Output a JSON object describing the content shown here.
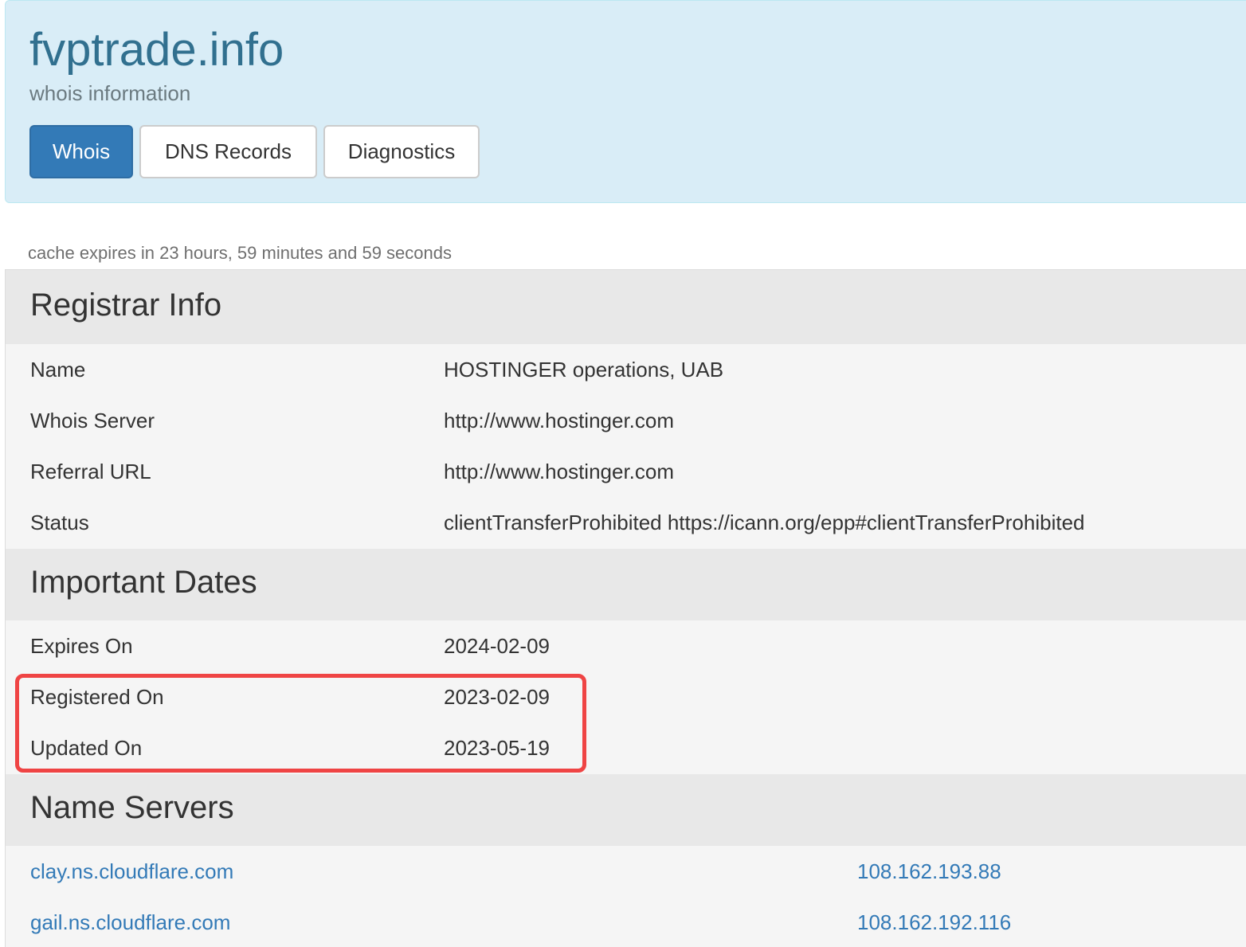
{
  "header": {
    "domain": "fvptrade.info",
    "subtitle": "whois information",
    "tabs": [
      "Whois",
      "DNS Records",
      "Diagnostics"
    ]
  },
  "cache_note": "cache expires in 23 hours, 59 minutes and 59 seconds",
  "registrar": {
    "heading": "Registrar Info",
    "rows": [
      {
        "label": "Name",
        "value": "HOSTINGER operations, UAB"
      },
      {
        "label": "Whois Server",
        "value": "http://www.hostinger.com"
      },
      {
        "label": "Referral URL",
        "value": "http://www.hostinger.com"
      },
      {
        "label": "Status",
        "value": "clientTransferProhibited https://icann.org/epp#clientTransferProhibited"
      }
    ]
  },
  "dates": {
    "heading": "Important Dates",
    "rows": [
      {
        "label": "Expires On",
        "value": "2024-02-09"
      },
      {
        "label": "Registered On",
        "value": "2023-02-09"
      },
      {
        "label": "Updated On",
        "value": "2023-05-19"
      }
    ]
  },
  "nameservers": {
    "heading": "Name Servers",
    "rows": [
      {
        "host": "clay.ns.cloudflare.com",
        "ip": "108.162.193.88"
      },
      {
        "host": "gail.ns.cloudflare.com",
        "ip": "108.162.192.116"
      }
    ]
  },
  "colors": {
    "accent": "#337ab7",
    "header_bg": "#d9edf7",
    "highlight": "#ef4444"
  }
}
